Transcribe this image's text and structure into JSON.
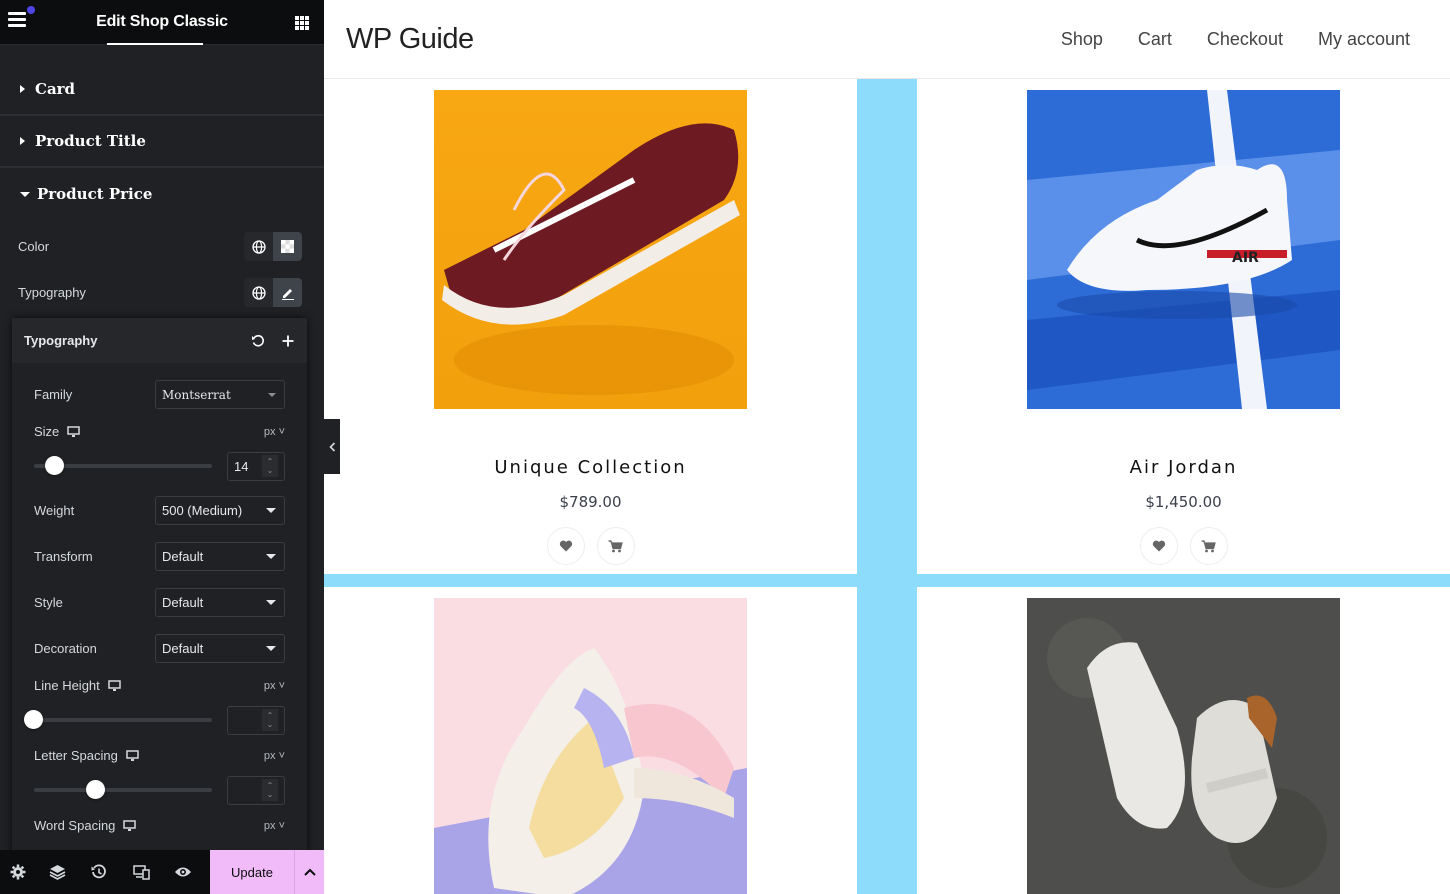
{
  "editor": {
    "title": "Edit Shop Classic",
    "sections": [
      {
        "label": "Card",
        "expanded": false
      },
      {
        "label": "Product Title",
        "expanded": false
      },
      {
        "label": "Product Price",
        "expanded": true
      }
    ],
    "controls": {
      "color_label": "Color",
      "typography_label": "Typography"
    },
    "typography_popover": {
      "title": "Typography",
      "family_label": "Family",
      "family_value": "Montserrat",
      "size_label": "Size",
      "size_unit": "px",
      "size_value": "14",
      "size_slider_fraction": 0.07,
      "weight_label": "Weight",
      "weight_value": "500 (Medium)",
      "transform_label": "Transform",
      "transform_value": "Default",
      "style_label": "Style",
      "style_value": "Default",
      "decoration_label": "Decoration",
      "decoration_value": "Default",
      "line_height_label": "Line Height",
      "line_height_unit": "px",
      "line_height_value": "",
      "line_height_slider_fraction": 0.0,
      "letter_spacing_label": "Letter Spacing",
      "letter_spacing_unit": "px",
      "letter_spacing_value": "",
      "letter_spacing_slider_fraction": 0.33,
      "word_spacing_label": "Word Spacing",
      "word_spacing_unit": "px"
    },
    "footer": {
      "update_label": "Update",
      "icons": [
        "settings-icon",
        "layers-icon",
        "history-icon",
        "responsive-icon",
        "preview-eye-icon"
      ]
    }
  },
  "site": {
    "title": "WP Guide",
    "nav": [
      "Shop",
      "Cart",
      "Checkout",
      "My account"
    ],
    "accent_color": "#8ddcfc"
  },
  "products": [
    {
      "title": "Unique Collection",
      "price": "$789.00",
      "image": "burgundy sneaker on orange background"
    },
    {
      "title": "Air Jordan",
      "price": "$1,450.00",
      "image": "white Nike Air sneaker on blue court"
    },
    {
      "title": "",
      "price": "",
      "image": "pastel Nike sneakers on pink/lilac background"
    },
    {
      "title": "",
      "price": "",
      "image": "white high-top sneakers on concrete"
    }
  ]
}
